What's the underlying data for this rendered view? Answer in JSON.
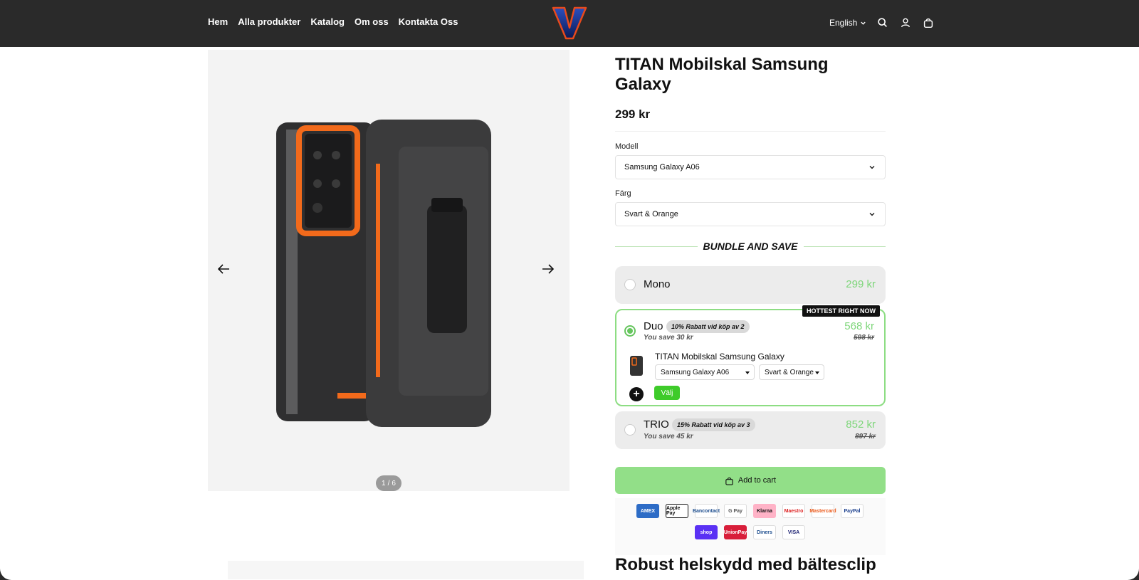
{
  "header": {
    "nav": [
      "Hem",
      "Alla produkter",
      "Katalog",
      "Om oss",
      "Kontakta Oss"
    ],
    "logo_letter": "V",
    "language": "English"
  },
  "gallery": {
    "counter_current": "1",
    "counter_sep": "/",
    "counter_total": "6"
  },
  "product": {
    "title": "TITAN Mobilskal Samsung Galaxy",
    "price": "299 kr",
    "model_label": "Modell",
    "model_value": "Samsung Galaxy A06",
    "color_label": "Färg",
    "color_value": "Svart & Orange"
  },
  "bundle": {
    "heading": "BUNDLE AND SAVE",
    "options": [
      {
        "name": "Mono",
        "price": "299 kr"
      },
      {
        "name": "Duo",
        "badge": "10% Rabatt vid köp av 2",
        "save": "You save 30 kr",
        "price": "568 kr",
        "old_price": "598 kr",
        "tag": "HOTTEST RIGHT NOW",
        "selected": true
      },
      {
        "name": "TRIO",
        "badge": "15% Rabatt vid köp av 3",
        "save": "You save 45 kr",
        "price": "852 kr",
        "old_price": "897 kr"
      }
    ],
    "sub_item": {
      "title": "TITAN Mobilskal Samsung Galaxy",
      "model": "Samsung Galaxy A06",
      "color": "Svart & Orange",
      "plus": "+",
      "choose_label": "Välj"
    }
  },
  "cart": {
    "label": "Add to cart"
  },
  "payments": {
    "row1": [
      "AMEX",
      "Apple Pay",
      "Bancontact",
      "G Pay",
      "Klarna",
      "Maestro",
      "Mastercard",
      "PayPal"
    ],
    "row2": [
      "shop",
      "UnionPay",
      "Diners",
      "VISA"
    ]
  },
  "description": {
    "heading": "Robust helskydd med bältesclip"
  },
  "colors": {
    "accent_green": "#66c55e",
    "cart_green": "#92df88",
    "header_bg": "#2a2a2a",
    "price_green": "#7ed67a"
  }
}
